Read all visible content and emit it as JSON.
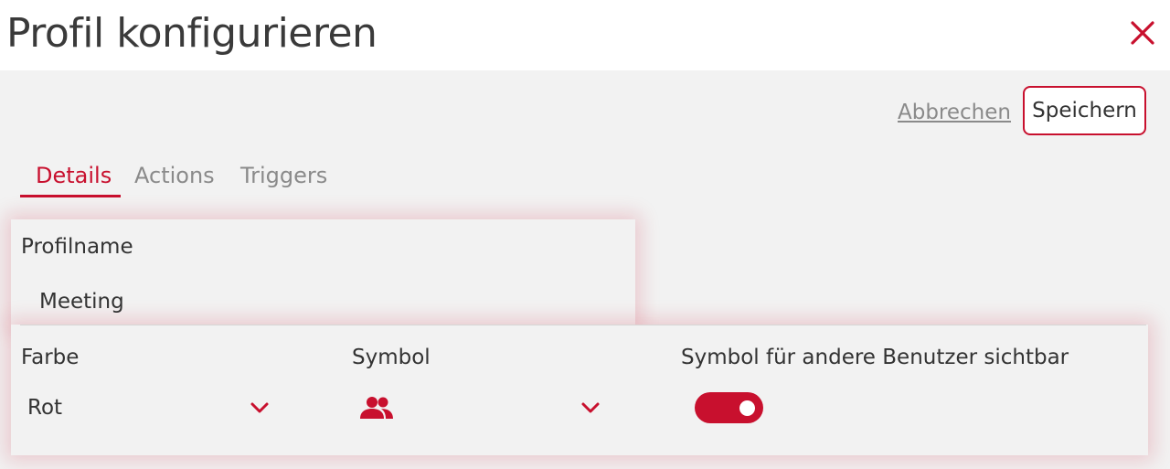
{
  "header": {
    "title": "Profil konfigurieren",
    "close_icon": "close-icon"
  },
  "actions": {
    "cancel_label": "Abbrechen",
    "save_label": "Speichern"
  },
  "tabs": [
    {
      "label": "Details",
      "active": true
    },
    {
      "label": "Actions",
      "active": false
    },
    {
      "label": "Triggers",
      "active": false
    }
  ],
  "form": {
    "profile_name_label": "Profilname",
    "profile_name_value": "Meeting",
    "color_label": "Farbe",
    "color_value": "Rot",
    "symbol_label": "Symbol",
    "symbol_value_icon": "people-icon",
    "visibility_label": "Symbol für andere Benutzer sichtbar",
    "visibility_enabled": true
  },
  "colors": {
    "accent": "#c8102e",
    "background": "#f2f2f2",
    "header": "#ffffff"
  }
}
